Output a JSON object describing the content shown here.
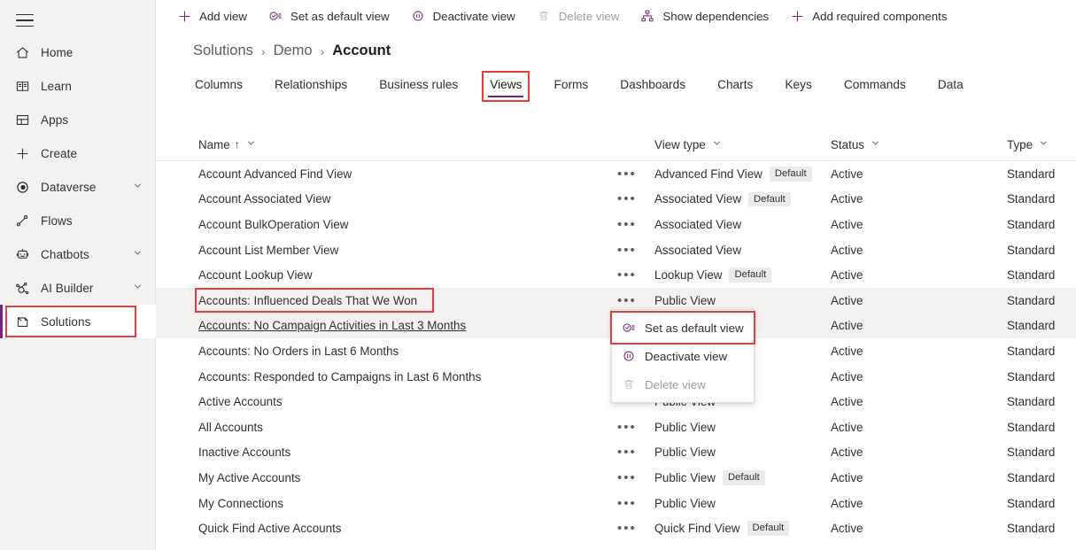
{
  "colors": {
    "accent": "#742774",
    "highlight_red": "#ee3a3a",
    "row_hover": "#f3f2f1",
    "nav_bg": "#f3f2f1",
    "badge_bg": "#edebe9"
  },
  "sidebar": {
    "hamburger_name": "global-navigation-button",
    "items": [
      {
        "label": "Home",
        "icon": "home-icon",
        "chevron": false,
        "active": false
      },
      {
        "label": "Learn",
        "icon": "book-icon",
        "chevron": false,
        "active": false
      },
      {
        "label": "Apps",
        "icon": "apps-grid-icon",
        "chevron": false,
        "active": false
      },
      {
        "label": "Create",
        "icon": "plus-icon",
        "chevron": false,
        "active": false
      },
      {
        "label": "Dataverse",
        "icon": "dataverse-icon",
        "chevron": true,
        "active": false
      },
      {
        "label": "Flows",
        "icon": "flows-icon",
        "chevron": false,
        "active": false
      },
      {
        "label": "Chatbots",
        "icon": "chatbot-icon",
        "chevron": true,
        "active": false
      },
      {
        "label": "AI Builder",
        "icon": "ai-builder-icon",
        "chevron": true,
        "active": false
      },
      {
        "label": "Solutions",
        "icon": "solutions-icon",
        "chevron": false,
        "active": true
      }
    ]
  },
  "commandbar": {
    "commands": [
      {
        "label": "Add view",
        "icon": "plus-icon",
        "disabled": false
      },
      {
        "label": "Set as default view",
        "icon": "check-list-icon",
        "disabled": false
      },
      {
        "label": "Deactivate view",
        "icon": "pause-circle-icon",
        "disabled": false
      },
      {
        "label": "Delete view",
        "icon": "trash-icon",
        "disabled": true
      },
      {
        "label": "Show dependencies",
        "icon": "hierarchy-icon",
        "disabled": false
      },
      {
        "label": "Add required components",
        "icon": "plus-icon",
        "disabled": false
      }
    ]
  },
  "breadcrumb": {
    "items": [
      {
        "label": "Solutions",
        "current": false
      },
      {
        "label": "Demo",
        "current": false
      },
      {
        "label": "Account",
        "current": true
      }
    ],
    "separator": "›"
  },
  "tabs": {
    "items": [
      {
        "label": "Columns",
        "selected": false,
        "highlighted": false
      },
      {
        "label": "Relationships",
        "selected": false,
        "highlighted": false
      },
      {
        "label": "Business rules",
        "selected": false,
        "highlighted": false
      },
      {
        "label": "Views",
        "selected": true,
        "highlighted": true
      },
      {
        "label": "Forms",
        "selected": false,
        "highlighted": false
      },
      {
        "label": "Dashboards",
        "selected": false,
        "highlighted": false
      },
      {
        "label": "Charts",
        "selected": false,
        "highlighted": false
      },
      {
        "label": "Keys",
        "selected": false,
        "highlighted": false
      },
      {
        "label": "Commands",
        "selected": false,
        "highlighted": false
      },
      {
        "label": "Data",
        "selected": false,
        "highlighted": false
      }
    ]
  },
  "table": {
    "columns": [
      {
        "key": "name",
        "label": "Name",
        "sorted": true,
        "sort_arrow": "↑"
      },
      {
        "key": "type",
        "label": "View type",
        "sorted": false,
        "sort_arrow": ""
      },
      {
        "key": "status",
        "label": "Status",
        "sorted": false,
        "sort_arrow": ""
      },
      {
        "key": "kind",
        "label": "Type",
        "sorted": false,
        "sort_arrow": ""
      }
    ],
    "more_glyph": "•••",
    "rows": [
      {
        "name": "Account Advanced Find View",
        "type": "Advanced Find View",
        "type_badge": "Default",
        "status": "Active",
        "kind": "Standard",
        "highlighted": false,
        "underline": false,
        "boxed": false,
        "show_more": true
      },
      {
        "name": "Account Associated View",
        "type": "Associated View",
        "type_badge": "Default",
        "status": "Active",
        "kind": "Standard",
        "highlighted": false,
        "underline": false,
        "boxed": false,
        "show_more": true
      },
      {
        "name": "Account BulkOperation View",
        "type": "Associated View",
        "type_badge": "",
        "status": "Active",
        "kind": "Standard",
        "highlighted": false,
        "underline": false,
        "boxed": false,
        "show_more": true
      },
      {
        "name": "Account List Member View",
        "type": "Associated View",
        "type_badge": "",
        "status": "Active",
        "kind": "Standard",
        "highlighted": false,
        "underline": false,
        "boxed": false,
        "show_more": true
      },
      {
        "name": "Account Lookup View",
        "type": "Lookup View",
        "type_badge": "Default",
        "status": "Active",
        "kind": "Standard",
        "highlighted": false,
        "underline": false,
        "boxed": false,
        "show_more": true
      },
      {
        "name": "Accounts: Influenced Deals That We Won",
        "type": "Public View",
        "type_badge": "",
        "status": "Active",
        "kind": "Standard",
        "highlighted": true,
        "underline": false,
        "boxed": true,
        "show_more": true
      },
      {
        "name": "Accounts: No Campaign Activities in Last 3 Months",
        "type": "",
        "type_badge": "",
        "status": "Active",
        "kind": "Standard",
        "highlighted": true,
        "underline": true,
        "boxed": false,
        "show_more": false
      },
      {
        "name": "Accounts: No Orders in Last 6 Months",
        "type": "",
        "type_badge": "",
        "status": "Active",
        "kind": "Standard",
        "highlighted": false,
        "underline": false,
        "boxed": false,
        "show_more": false
      },
      {
        "name": "Accounts: Responded to Campaigns in Last 6 Months",
        "type": "",
        "type_badge": "",
        "status": "Active",
        "kind": "Standard",
        "highlighted": false,
        "underline": false,
        "boxed": false,
        "show_more": false
      },
      {
        "name": "Active Accounts",
        "type": "Public View",
        "type_badge": "",
        "status": "Active",
        "kind": "Standard",
        "highlighted": false,
        "underline": false,
        "boxed": false,
        "show_more": true
      },
      {
        "name": "All Accounts",
        "type": "Public View",
        "type_badge": "",
        "status": "Active",
        "kind": "Standard",
        "highlighted": false,
        "underline": false,
        "boxed": false,
        "show_more": true
      },
      {
        "name": "Inactive Accounts",
        "type": "Public View",
        "type_badge": "",
        "status": "Active",
        "kind": "Standard",
        "highlighted": false,
        "underline": false,
        "boxed": false,
        "show_more": true
      },
      {
        "name": "My Active Accounts",
        "type": "Public View",
        "type_badge": "Default",
        "status": "Active",
        "kind": "Standard",
        "highlighted": false,
        "underline": false,
        "boxed": false,
        "show_more": true
      },
      {
        "name": "My Connections",
        "type": "Public View",
        "type_badge": "",
        "status": "Active",
        "kind": "Standard",
        "highlighted": false,
        "underline": false,
        "boxed": false,
        "show_more": true
      },
      {
        "name": "Quick Find Active Accounts",
        "type": "Quick Find View",
        "type_badge": "Default",
        "status": "Active",
        "kind": "Standard",
        "highlighted": false,
        "underline": false,
        "boxed": false,
        "show_more": true
      }
    ]
  },
  "context_menu": {
    "items": [
      {
        "label": "Set as default view",
        "icon": "check-list-icon",
        "disabled": false,
        "highlighted": true
      },
      {
        "label": "Deactivate view",
        "icon": "pause-circle-icon",
        "disabled": false,
        "highlighted": false
      },
      {
        "label": "Delete view",
        "icon": "trash-icon",
        "disabled": true,
        "highlighted": false
      }
    ]
  }
}
